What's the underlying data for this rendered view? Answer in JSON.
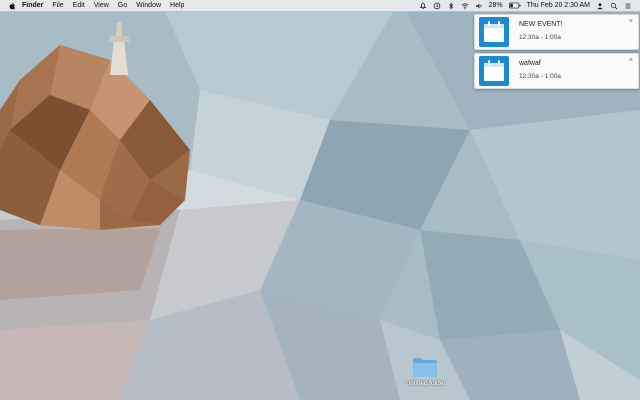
{
  "menubar": {
    "app_name": "Finder",
    "menus": [
      "File",
      "Edit",
      "View",
      "Go",
      "Window",
      "Help"
    ],
    "battery_percent": "28%",
    "clock": "Thu Feb 20  2:30 AM"
  },
  "notifications": [
    {
      "title": "NEW EVENT!",
      "time": "12:30a - 1:00a",
      "close": "×",
      "icon": "calendar-icon"
    },
    {
      "title": "wafwaf",
      "time": "12:30a - 1:00a",
      "close": "×",
      "icon": "calendar-icon"
    }
  ],
  "desktop": {
    "folder_label": "untitled folder",
    "folder_icon": "folder-icon"
  },
  "colors": {
    "accent": "#1a8ad4",
    "wallpaper_base": "#a9bcc4",
    "rock": "#9a6a45"
  }
}
